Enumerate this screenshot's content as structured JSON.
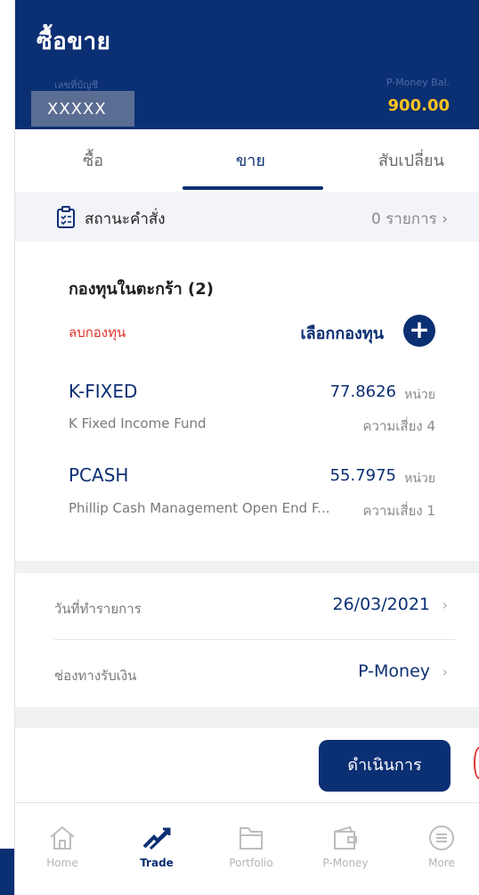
{
  "header": {
    "title": "ซื้อขาย",
    "account_label": "เลขที่บัญชี",
    "account_value": "XXXXX",
    "balance_label": "P-Money Bal.",
    "balance_value": "900.00"
  },
  "tabs": [
    {
      "label": "ซื้อ",
      "active": false
    },
    {
      "label": "ขาย",
      "active": true
    },
    {
      "label": "สับเปลี่ยน",
      "active": false
    }
  ],
  "order_status": {
    "label": "สถานะคำสั่ง",
    "count_text": "0 รายการ",
    "icon": "clipboard-list-icon"
  },
  "basket": {
    "title": "กองทุนในตะกร้า (2)",
    "remove_label": "ลบกองทุน",
    "select_label": "เลือกกองทุน",
    "add_icon": "plus-circle-icon",
    "funds": [
      {
        "code": "K-FIXED",
        "units": "77.8626",
        "unit_label": "หน่วย",
        "name": "K Fixed Income Fund",
        "risk": "ความเสี่ยง 4"
      },
      {
        "code": "PCASH",
        "units": "55.7975",
        "unit_label": "หน่วย",
        "name": "Phillip Cash Management Open End F...",
        "risk": "ความเสี่ยง 1"
      }
    ]
  },
  "transaction_date": {
    "label": "วันที่ทำรายการ",
    "value": "26/03/2021"
  },
  "payment_channel": {
    "label": "ช่องทางรับเงิน",
    "value": "P-Money"
  },
  "proceed_button": "ดำเนินการ",
  "tabbar": [
    {
      "label": "Home",
      "icon": "home-icon",
      "active": false
    },
    {
      "label": "Trade",
      "icon": "trade-icon",
      "active": true
    },
    {
      "label": "Portfolio",
      "icon": "folder-icon",
      "active": false
    },
    {
      "label": "P-Money",
      "icon": "wallet-icon",
      "active": false
    },
    {
      "label": "More",
      "icon": "menu-circle-icon",
      "active": false
    }
  ],
  "colors": {
    "brand": "#0b2f73",
    "balance": "#ffc31f",
    "danger": "#e0312b"
  }
}
